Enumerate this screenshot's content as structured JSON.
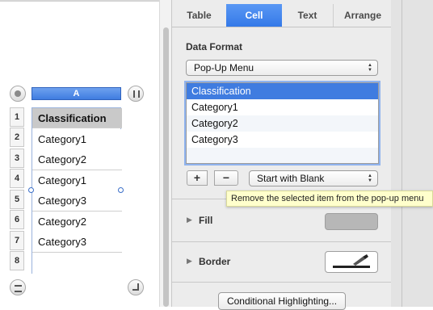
{
  "tabs": [
    {
      "label": "Table",
      "active": false
    },
    {
      "label": "Cell",
      "active": true
    },
    {
      "label": "Text",
      "active": false
    },
    {
      "label": "Arrange",
      "active": false
    }
  ],
  "sheet": {
    "column_header": "A",
    "rows": [
      {
        "num": "1",
        "value": "Classification",
        "header": true
      },
      {
        "num": "2",
        "value": "Category1"
      },
      {
        "num": "3",
        "value": "Category2"
      },
      {
        "num": "4",
        "value": "Category1"
      },
      {
        "num": "5",
        "value": "Category3"
      },
      {
        "num": "6",
        "value": "Category2"
      },
      {
        "num": "7",
        "value": "Category3"
      },
      {
        "num": "8",
        "value": ""
      }
    ]
  },
  "inspector": {
    "data_format_label": "Data Format",
    "format_popup": "Pop-Up Menu",
    "items": [
      "Classification",
      "Category1",
      "Category2",
      "Category3"
    ],
    "selected_item": "Classification",
    "add_button": "+",
    "remove_button": "−",
    "start_popup": "Start with Blank",
    "tooltip": "Remove the selected item from the pop-up menu",
    "fill_label": "Fill",
    "border_label": "Border",
    "conditional_button": "Conditional Highlighting..."
  },
  "colors": {
    "accent": "#3f7ce0",
    "selection": "#3f7ce0",
    "tooltip_bg": "#ffffcc",
    "fill_well": "#b7b7b7"
  }
}
